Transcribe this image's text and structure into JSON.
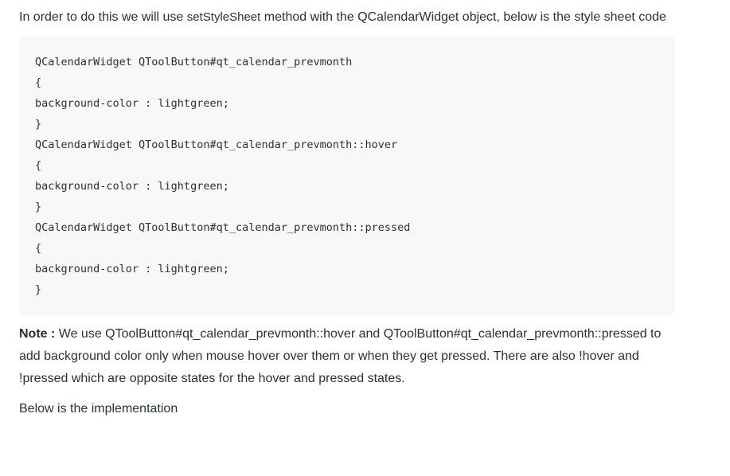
{
  "intro": {
    "before": "In order to do this we will use ",
    "method": "setStyleSheet",
    "after": " method with the QCalendarWidget object, below is the style sheet code"
  },
  "code_lines": [
    "QCalendarWidget QToolButton#qt_calendar_prevmonth",
    "{",
    "background-color : lightgreen;",
    "}",
    "QCalendarWidget QToolButton#qt_calendar_prevmonth::hover",
    "{",
    "background-color : lightgreen;",
    "}",
    "QCalendarWidget QToolButton#qt_calendar_prevmonth::pressed",
    "{",
    "background-color : lightgreen;",
    "}"
  ],
  "note": {
    "label": "Note :",
    "text": " We use QToolButton#qt_calendar_prevmonth::hover and QToolButton#qt_calendar_prevmonth::pressed to add background color only when mouse hover over them or when they get pressed. There are also !hover and !pressed which are opposite states for the hover and pressed states."
  },
  "tail": "Below is the implementation"
}
